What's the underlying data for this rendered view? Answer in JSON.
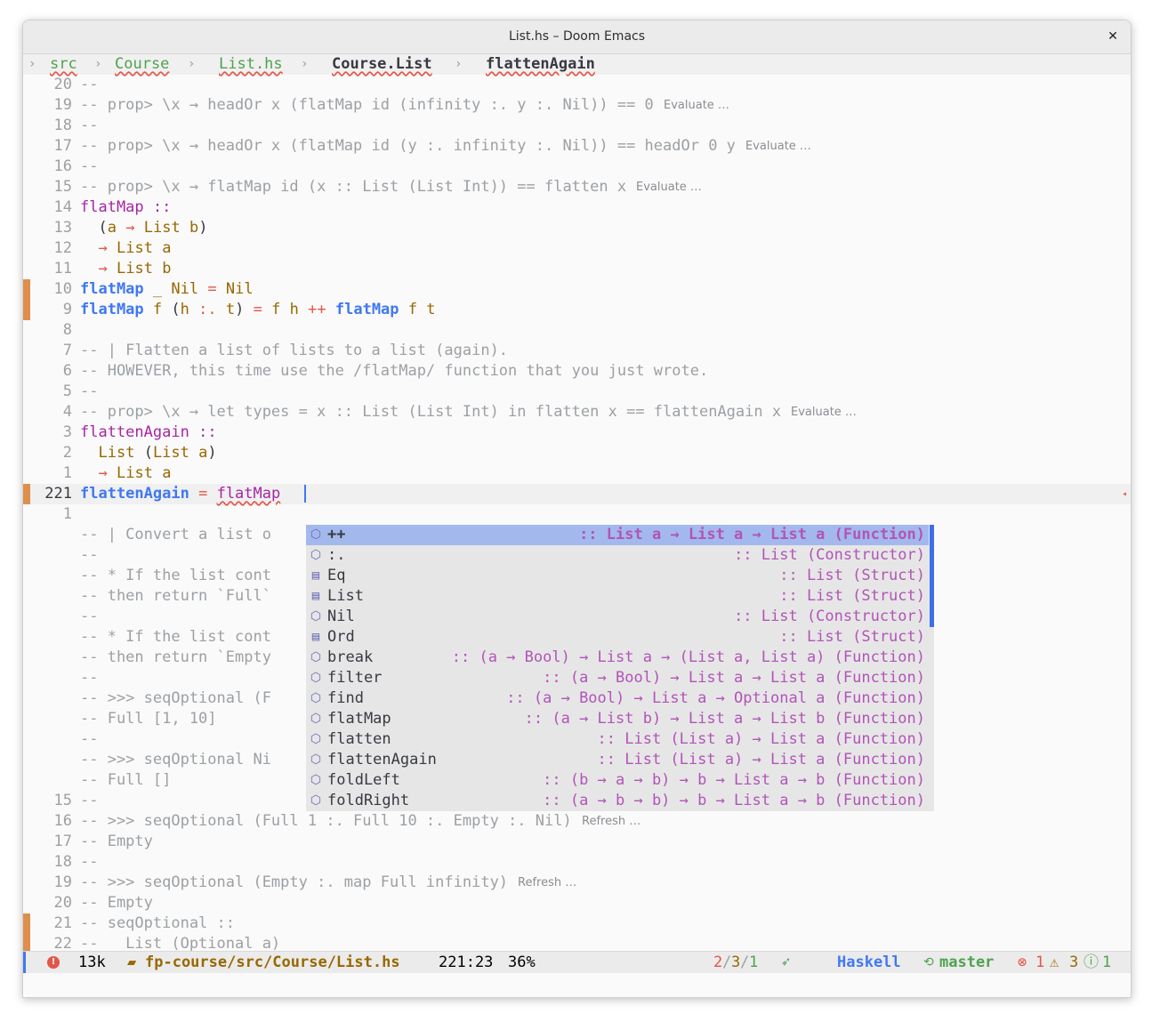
{
  "window": {
    "title": "List.hs – Doom Emacs"
  },
  "header": {
    "crumbs": [
      "src",
      "Course",
      "List.hs",
      "Course.List",
      "flattenAgain"
    ]
  },
  "editor": {
    "lines": [
      {
        "num": "20",
        "code": "--"
      },
      {
        "num": "19",
        "code": "-- prop> \\x → headOr x (flatMap id (infinity :. y :. Nil)) == 0",
        "lens": "Evaluate …"
      },
      {
        "num": "18",
        "code": "--"
      },
      {
        "num": "17",
        "code": "-- prop> \\x → headOr x (flatMap id (y :. infinity :. Nil)) == headOr 0 y",
        "lens": "Evaluate …"
      },
      {
        "num": "16",
        "code": "--"
      },
      {
        "num": "15",
        "code": "-- prop> \\x → flatMap id (x :: List (List Int)) == flatten x",
        "lens": "Evaluate …"
      },
      {
        "num": "14",
        "code": "flatMap ::"
      },
      {
        "num": "13",
        "code": "  (a → List b)"
      },
      {
        "num": "12",
        "code": "  → List a"
      },
      {
        "num": "11",
        "code": "  → List b"
      },
      {
        "num": "10",
        "code": "flatMap _ Nil = Nil"
      },
      {
        "num": "9",
        "code": "flatMap f (h :. t) = f h ++ flatMap f t"
      },
      {
        "num": "8",
        "code": ""
      },
      {
        "num": "7",
        "code": "-- | Flatten a list of lists to a list (again)."
      },
      {
        "num": "6",
        "code": "-- HOWEVER, this time use the /flatMap/ function that you just wrote."
      },
      {
        "num": "5",
        "code": "--"
      },
      {
        "num": "4",
        "code": "-- prop> \\x → let types = x :: List (List Int) in flatten x == flattenAgain x",
        "lens": "Evaluate …"
      },
      {
        "num": "3",
        "code": "flattenAgain ::"
      },
      {
        "num": "2",
        "code": "  List (List a)"
      },
      {
        "num": "1",
        "code": "  → List a"
      },
      {
        "num": "221",
        "code": "flattenAgain = flatMap"
      },
      {
        "num": "1",
        "code": ""
      },
      {
        "num": "",
        "code": "-- | Convert a list o"
      },
      {
        "num": "",
        "code": "--"
      },
      {
        "num": "",
        "code": "-- * If the list cont"
      },
      {
        "num": "",
        "code": "-- then return `Full`"
      },
      {
        "num": "",
        "code": "--"
      },
      {
        "num": "",
        "code": "-- * If the list cont"
      },
      {
        "num": "",
        "code": "-- then return `Empty"
      },
      {
        "num": "",
        "code": "--"
      },
      {
        "num": "",
        "code": "-- >>> seqOptional (F"
      },
      {
        "num": "",
        "code": "-- Full [1, 10]"
      },
      {
        "num": "",
        "code": "--"
      },
      {
        "num": "",
        "code": "-- >>> seqOptional Ni"
      },
      {
        "num": "",
        "code": "-- Full []"
      },
      {
        "num": "15",
        "code": "--"
      },
      {
        "num": "16",
        "code": "-- >>> seqOptional (Full 1 :. Full 10 :. Empty :. Nil)",
        "lens": "Refresh …"
      },
      {
        "num": "17",
        "code": "-- Empty"
      },
      {
        "num": "18",
        "code": "--"
      },
      {
        "num": "19",
        "code": "-- >>> seqOptional (Empty :. map Full infinity)",
        "lens": "Refresh …"
      },
      {
        "num": "20",
        "code": "-- Empty"
      },
      {
        "num": "21",
        "code": "-- seqOptional ::"
      },
      {
        "num": "22",
        "code": "--   List (Optional a)"
      }
    ]
  },
  "completion": {
    "items": [
      {
        "icon": "⬡",
        "label": "++",
        "sig": ":: List a → List a → List a (Function)",
        "selected": true
      },
      {
        "icon": "⬡",
        "label": ":.",
        "sig": ":: List (Constructor)"
      },
      {
        "icon": "▤",
        "label": "Eq",
        "sig": ":: List (Struct)"
      },
      {
        "icon": "▤",
        "label": "List",
        "sig": ":: List (Struct)"
      },
      {
        "icon": "⬡",
        "label": "Nil",
        "sig": ":: List (Constructor)"
      },
      {
        "icon": "▤",
        "label": "Ord",
        "sig": ":: List (Struct)"
      },
      {
        "icon": "⬡",
        "label": "break",
        "sig": ":: (a → Bool) → List a → (List a, List a) (Function)"
      },
      {
        "icon": "⬡",
        "label": "filter",
        "sig": ":: (a → Bool) → List a → List a (Function)"
      },
      {
        "icon": "⬡",
        "label": "find",
        "sig": ":: (a → Bool) → List a → Optional a (Function)"
      },
      {
        "icon": "⬡",
        "label": "flatMap",
        "sig": ":: (a → List b) → List a → List b (Function)"
      },
      {
        "icon": "⬡",
        "label": "flatten",
        "sig": ":: List (List a) → List a (Function)"
      },
      {
        "icon": "⬡",
        "label": "flattenAgain",
        "sig": ":: List (List a) → List a (Function)"
      },
      {
        "icon": "⬡",
        "label": "foldLeft",
        "sig": ":: (b → a → b) → b → List a → b (Function)"
      },
      {
        "icon": "⬡",
        "label": "foldRight",
        "sig": ":: (a → b → b) → b → List a → b (Function)"
      }
    ]
  },
  "modeline": {
    "size": "13k",
    "file": "fp-course/src/Course/List.hs",
    "position": "221:23",
    "percent": "36%",
    "ctx_a": "2",
    "ctx_b": "3",
    "ctx_c": "1",
    "rocket_icon": "rocket-icon",
    "mode": "Haskell",
    "branch": "master",
    "errors": "1",
    "warnings": "3",
    "infos": "1",
    "colors": {
      "error": "#e45649",
      "warning": "#986801",
      "info": "#50a14f",
      "mode": "#4078f2"
    }
  }
}
